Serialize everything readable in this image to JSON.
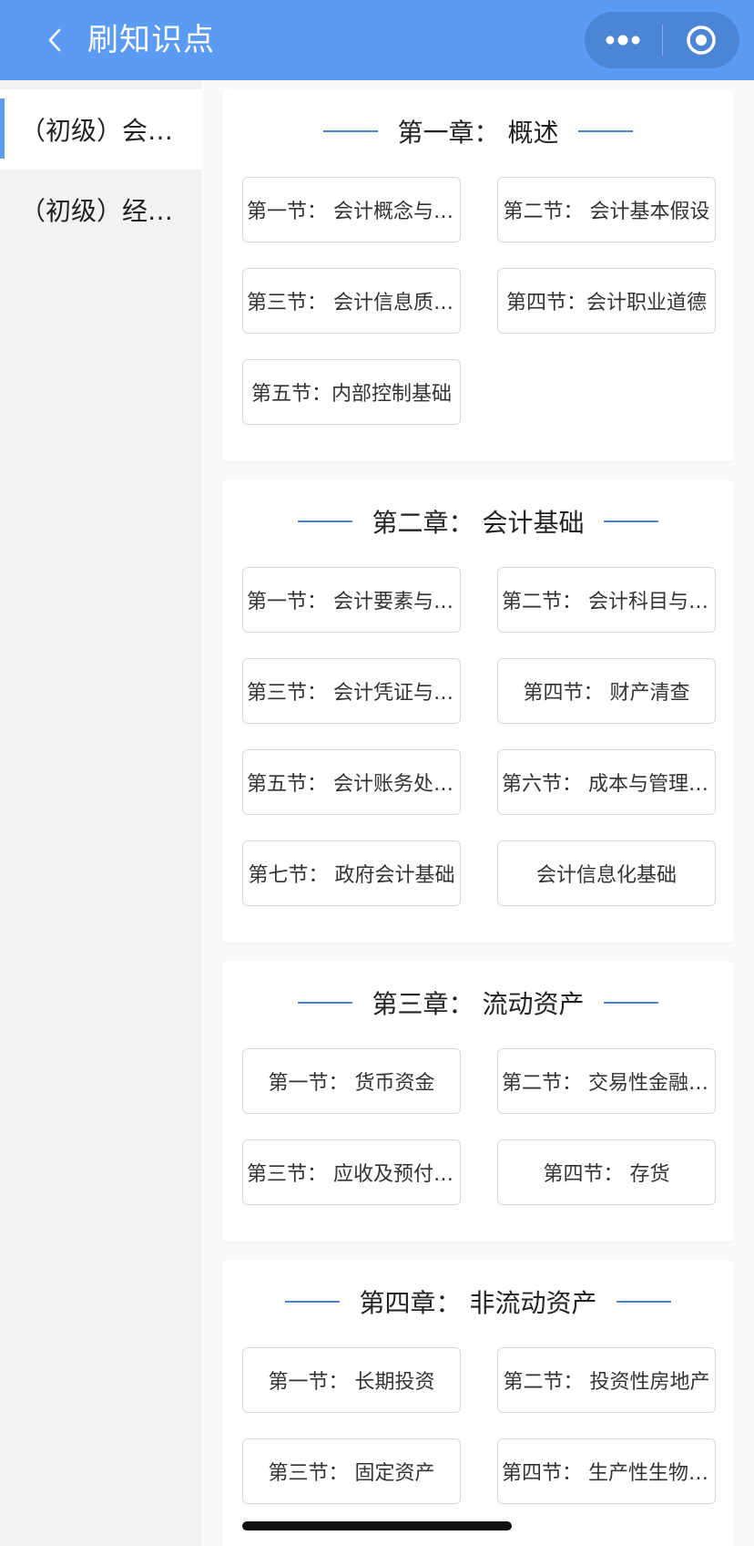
{
  "header": {
    "title": "刷知识点",
    "back_icon": "chevron-left-icon",
    "more_icon": "more-dots-icon",
    "close_icon": "target-circle-icon",
    "color": "#5b9bf4"
  },
  "sidebar": {
    "items": [
      {
        "label": "（初级）会计基础"
      },
      {
        "label": "（初级）经济法基础"
      }
    ],
    "accent": "#5b9bf4"
  },
  "chapters": [
    {
      "title": "第一章：  概述",
      "sections": [
        "第一节：  会计概念与目标",
        "第二节：  会计基本假设",
        "第三节：  会计信息质量要求",
        "第四节：会计职业道德",
        "第五节：内部控制基础"
      ]
    },
    {
      "title": "第二章：  会计基础",
      "sections": [
        "第一节：  会计要素与会计等式",
        "第二节：  会计科目与账户",
        "第三节：  会计凭证与账簿",
        "第四节：  财产清查",
        "第五节：  会计账务处理程序",
        "第六节：  成本与管理会计基础",
        "第七节：  政府会计基础",
        "会计信息化基础"
      ]
    },
    {
      "title": "第三章：  流动资产",
      "sections": [
        "第一节：  货币资金",
        "第二节：  交易性金融资产",
        "第三节：  应收及预付款项",
        "第四节：  存货"
      ]
    },
    {
      "title": "第四章：  非流动资产",
      "sections": [
        "第一节：  长期投资",
        "第二节：  投资性房地产",
        "第三节：  固定资产",
        "第四节：  生产性生物资产"
      ]
    }
  ]
}
